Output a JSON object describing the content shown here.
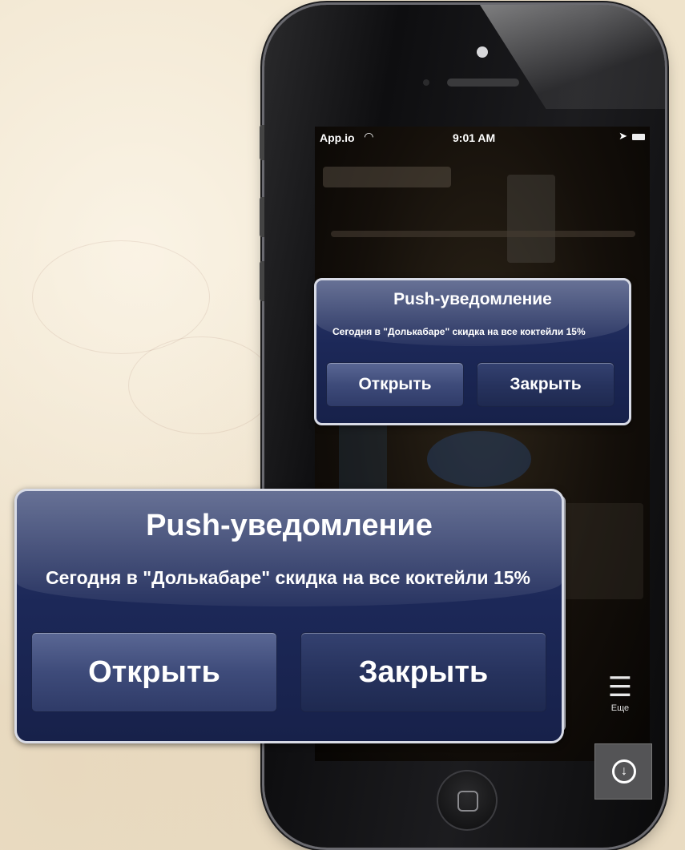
{
  "status_bar": {
    "carrier": "App.io",
    "time": "9:01 AM"
  },
  "alert_small": {
    "title": "Push-уведомление",
    "message": "Сегодня в \"Долькабаре\" скидка на все коктейли 15%",
    "open_label": "Открыть",
    "close_label": "Закрыть"
  },
  "alert_large": {
    "title": "Push-уведомление",
    "message": "Сегодня в \"Долькабаре\" скидка на все коктейли 15%",
    "open_label": "Открыть",
    "close_label": "Закрыть"
  },
  "tab_more": {
    "label": "Еще",
    "icon": "menu-list-icon"
  },
  "download_button": {
    "icon": "download-icon"
  },
  "colors": {
    "alert_bg": "#1c2858",
    "alert_border": "#d8dbe6",
    "page_bg": "#efe3cb"
  }
}
